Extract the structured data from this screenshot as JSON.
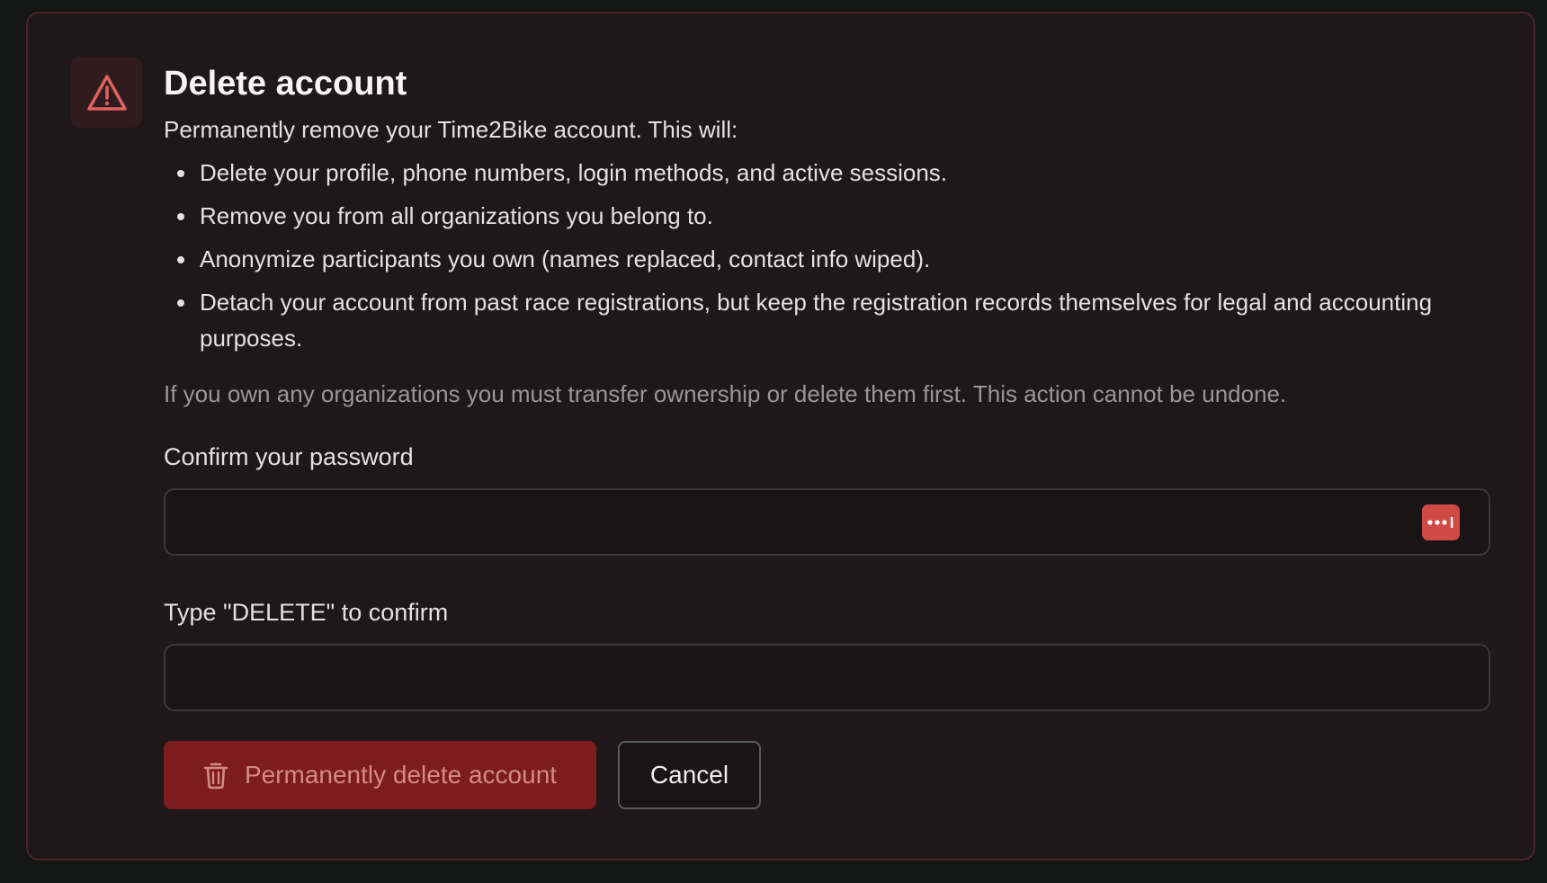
{
  "dialog": {
    "title": "Delete account",
    "icon": "warning-triangle-icon",
    "intro": "Permanently remove your Time2Bike account. This will:",
    "bullets": [
      "Delete your profile, phone numbers, login methods, and active sessions.",
      "Remove you from all organizations you belong to.",
      "Anonymize participants you own (names replaced, contact info wiped).",
      "Detach your account from past race registrations, but keep the registration records themselves for legal and accounting purposes."
    ],
    "note": "If you own any organizations you must transfer ownership or delete them first. This action cannot be undone."
  },
  "password_field": {
    "label": "Confirm your password",
    "value": "",
    "manager_icon": "password-manager-icon"
  },
  "confirm_field": {
    "label": "Type \"DELETE\" to confirm",
    "value": ""
  },
  "actions": {
    "delete_label": "Permanently delete account",
    "delete_icon": "trash-icon",
    "cancel_label": "Cancel"
  },
  "colors": {
    "accent_danger": "#cf4a45",
    "delete_button_bg": "#7c1c1e",
    "panel_border": "#4a2428"
  }
}
